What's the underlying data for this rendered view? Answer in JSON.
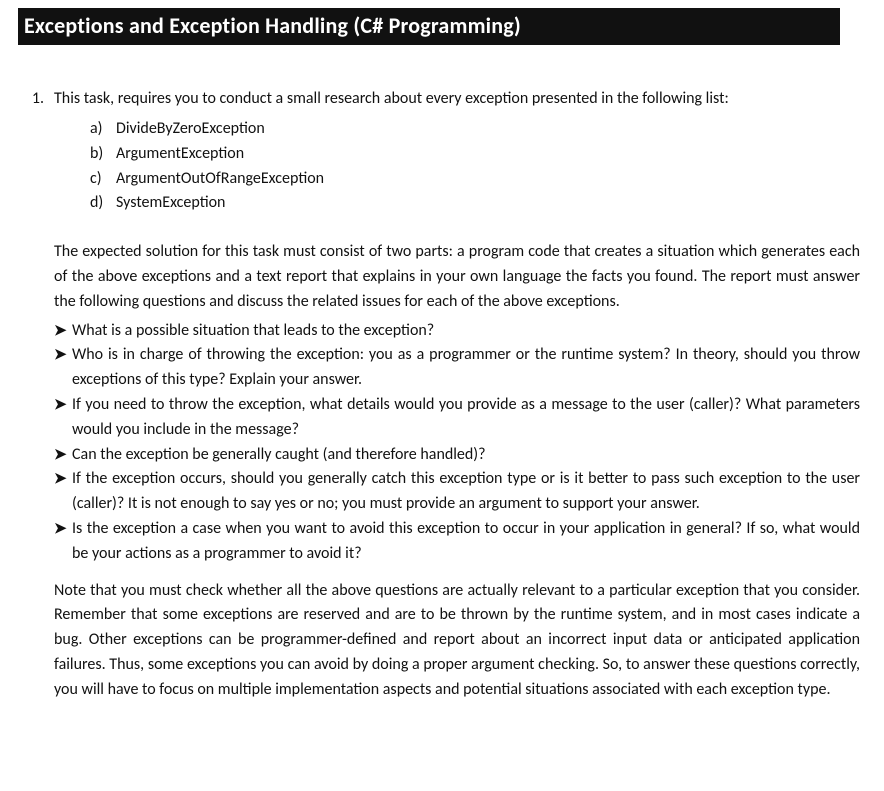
{
  "title": "Exceptions and Exception Handling (C# Programming)",
  "task": {
    "number": "1.",
    "intro": "This task, requires you to conduct a small research about every exception presented in the following list:",
    "letters": [
      {
        "label": "a)",
        "text": "DivideByZeroException"
      },
      {
        "label": "b)",
        "text": "ArgumentException"
      },
      {
        "label": "c)",
        "text": "ArgumentOutOfRangeException"
      },
      {
        "label": "d)",
        "text": "SystemException"
      }
    ],
    "solution_intro": "The expected solution for this task must consist of two parts: a program code that creates a situation which generates each of the above exceptions and a text report that explains in your own language the facts you found. The report must answer the following questions and discuss the related issues for each of the above exceptions.",
    "bullets": [
      "What is a possible situation that leads to the exception?",
      "Who is in charge of throwing the exception: you as a programmer or the runtime system? In theory, should you throw exceptions of this type? Explain your answer.",
      "If you need to throw the exception, what details would you provide as a message to the user (caller)? What parameters would you include in the message?",
      "Can the exception be generally caught (and therefore handled)?",
      "If the exception occurs, should you generally catch this exception type or is it better to pass such exception to the user (caller)? It is not enough to say yes or no; you must provide an argument to support your answer.",
      "Is the exception a case when you want to avoid this exception to occur in your application in general? If so, what would be your actions as a programmer to avoid it?"
    ],
    "note": "Note that you must check whether all the above questions are actually relevant to a particular exception that you consider. Remember that some exceptions are reserved and are to be thrown by the runtime system, and in most cases indicate a bug. Other exceptions can be programmer-defined and report about an incorrect input data or anticipated application failures. Thus, some exceptions you can avoid by doing a proper argument checking. So, to answer these questions correctly, you will have to focus on multiple implementation aspects and potential situations associated with each exception type."
  },
  "bullet_glyph": "➤"
}
